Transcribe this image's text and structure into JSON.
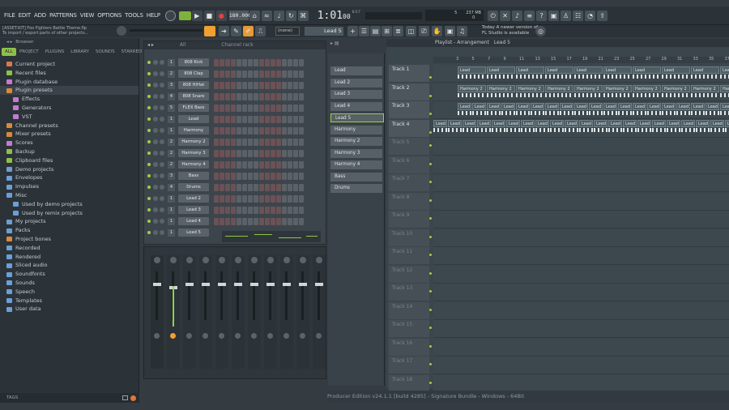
{
  "menu": [
    "FILE",
    "EDIT",
    "ADD",
    "PATTERNS",
    "VIEW",
    "OPTIONS",
    "TOOLS",
    "HELP"
  ],
  "project": {
    "file_hint": "[ASSET:KIT] Foo Fighters Battle Theme.flp",
    "subtitle": "To import / export parts of other projects..."
  },
  "transport": {
    "tempo": "180.000",
    "time": "1:01",
    "time_sub": "00",
    "bst": "B:S:T"
  },
  "cpu": {
    "value": "237 MB",
    "percent": "5",
    "zero": "0"
  },
  "tooltip": {
    "line1": "Today  A newer version of",
    "line2": "FL Studio is available"
  },
  "toolbar2": {
    "snap": "(none)",
    "pattern": "Lead 5",
    "channel_rack_title": "Channel rack",
    "playlist_title": "Playlist - Arrangement",
    "playlist_pattern": "Lead 5",
    "all": "All"
  },
  "browser": {
    "tabs": [
      "ALL",
      "PROJECT",
      "PLUGINS",
      "LIBRARY",
      "SOUNDS",
      "STARRED"
    ],
    "header": "Browser",
    "items": [
      {
        "label": "Current project",
        "color": "#d9794f",
        "indent": 0
      },
      {
        "label": "Recent files",
        "color": "#8fbf4a",
        "indent": 0
      },
      {
        "label": "Plugin database",
        "color": "#c47ad0",
        "indent": 0
      },
      {
        "label": "Plugin presets",
        "color": "#d98a3a",
        "indent": 0,
        "sel": true
      },
      {
        "label": "Effects",
        "color": "#c47ad0",
        "indent": 1
      },
      {
        "label": "Generators",
        "color": "#c47ad0",
        "indent": 1
      },
      {
        "label": "VST",
        "color": "#c47ad0",
        "indent": 1
      },
      {
        "label": "Channel presets",
        "color": "#d98a3a",
        "indent": 0
      },
      {
        "label": "Mixer presets",
        "color": "#d98a3a",
        "indent": 0
      },
      {
        "label": "Scores",
        "color": "#c47ad0",
        "indent": 0
      },
      {
        "label": "Backup",
        "color": "#8fbf4a",
        "indent": 0
      },
      {
        "label": "Clipboard files",
        "color": "#8fbf4a",
        "indent": 0
      },
      {
        "label": "Demo projects",
        "color": "#6d9ed6",
        "indent": 0
      },
      {
        "label": "Envelopes",
        "color": "#6d9ed6",
        "indent": 0
      },
      {
        "label": "Impulses",
        "color": "#6d9ed6",
        "indent": 0
      },
      {
        "label": "Misc",
        "color": "#6d9ed6",
        "indent": 0
      },
      {
        "label": "Used by demo projects",
        "color": "#6d9ed6",
        "indent": 1
      },
      {
        "label": "Used by remix projects",
        "color": "#6d9ed6",
        "indent": 1
      },
      {
        "label": "My projects",
        "color": "#6d9ed6",
        "indent": 0
      },
      {
        "label": "Packs",
        "color": "#6d9ed6",
        "indent": 0
      },
      {
        "label": "Project bones",
        "color": "#d98a3a",
        "indent": 0
      },
      {
        "label": "Recorded",
        "color": "#6d9ed6",
        "indent": 0
      },
      {
        "label": "Rendered",
        "color": "#6d9ed6",
        "indent": 0
      },
      {
        "label": "Sliced audio",
        "color": "#6d9ed6",
        "indent": 0
      },
      {
        "label": "Soundfonts",
        "color": "#6d9ed6",
        "indent": 0
      },
      {
        "label": "Sounds",
        "color": "#6d9ed6",
        "indent": 0
      },
      {
        "label": "Speech",
        "color": "#6d9ed6",
        "indent": 0
      },
      {
        "label": "Templates",
        "color": "#6d9ed6",
        "indent": 0
      },
      {
        "label": "User data",
        "color": "#6d9ed6",
        "indent": 0
      }
    ],
    "footer": "TAGS"
  },
  "channels": [
    {
      "name": "808 Kick",
      "num": "1"
    },
    {
      "name": "808 Clap",
      "num": "2"
    },
    {
      "name": "808 HiHat",
      "num": "3"
    },
    {
      "name": "808 Snare",
      "num": "4"
    },
    {
      "name": "FLEX Bass",
      "num": "5"
    },
    {
      "name": "Lead",
      "num": "1"
    },
    {
      "name": "Harmony",
      "num": "1"
    },
    {
      "name": "Harmony 2",
      "num": "2"
    },
    {
      "name": "Harmony 3",
      "num": "2"
    },
    {
      "name": "Harmony 4",
      "num": "2"
    },
    {
      "name": "Bass",
      "num": "3"
    },
    {
      "name": "Drums",
      "num": "4"
    },
    {
      "name": "Lead 2",
      "num": "1"
    },
    {
      "name": "Lead 3",
      "num": "1"
    },
    {
      "name": "Lead 4",
      "num": "1"
    },
    {
      "name": "Lead 5",
      "num": "1"
    }
  ],
  "patterns": [
    "Lead",
    "Lead 2",
    "Lead 3",
    "Lead 4",
    "Lead 5",
    "Harmony",
    "Harmony 2",
    "Harmony 3",
    "Harmony 4",
    "Bass",
    "Drums"
  ],
  "bar_numbers": [
    "3",
    "5",
    "7",
    "9",
    "11",
    "13",
    "15",
    "17",
    "19",
    "21",
    "23",
    "25",
    "27",
    "29",
    "31",
    "33",
    "35",
    "37",
    "39"
  ],
  "tracks": [
    "Track 1",
    "Track 2",
    "Track 3",
    "Track 4",
    "Track 5",
    "Track 6",
    "Track 7",
    "Track 8",
    "Track 9",
    "Track 10",
    "Track 11",
    "Track 12",
    "Track 13",
    "Track 14",
    "Track 15",
    "Track 16",
    "Track 17",
    "Track 18"
  ],
  "status": "Producer Edition v24.1.1 [build 4285] - Signature Bundle - Windows - 64Bit",
  "colors": {
    "accent_green": "#9bd042",
    "accent_orange": "#f0a030",
    "step_on": "#6a5257",
    "step_off": "#5b6267"
  }
}
